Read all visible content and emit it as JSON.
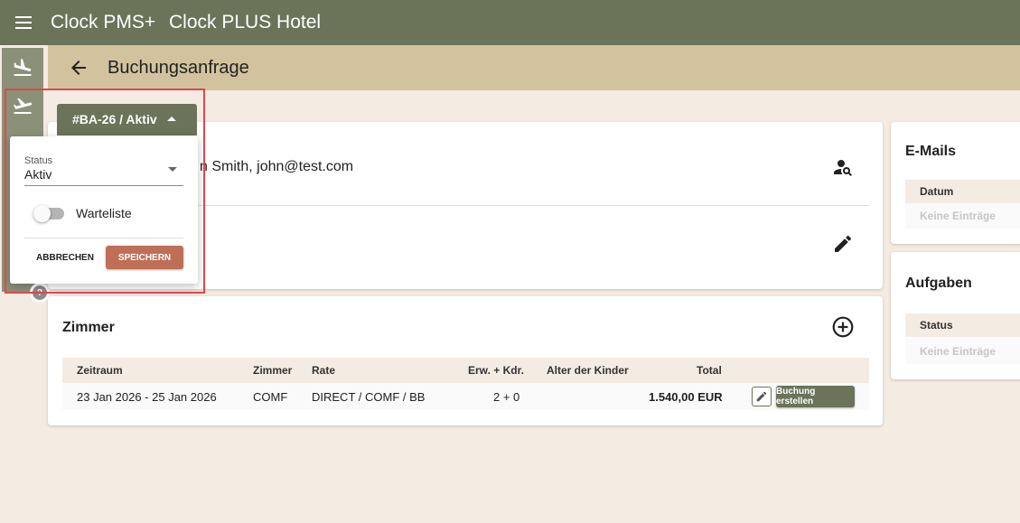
{
  "app": {
    "name": "Clock PMS+",
    "hotel": "Clock PLUS Hotel"
  },
  "header": {
    "title": "Buchungsanfrage"
  },
  "nav_rail": {
    "items": [
      {
        "icon": "flight-land-icon"
      },
      {
        "icon": "flight-takeoff-icon"
      }
    ],
    "help_label": "?"
  },
  "status_chip": {
    "label": "#BA-26 / Aktiv"
  },
  "status_popup": {
    "status_label": "Status",
    "status_value": "Aktiv",
    "waitlist_label": "Warteliste",
    "waitlist_enabled": false,
    "cancel_label": "ABBRECHEN",
    "save_label": "SPEICHERN"
  },
  "guest": {
    "text": "n Smith, john@test.com"
  },
  "rooms": {
    "title": "Zimmer",
    "columns": [
      "Zeitraum",
      "Zimmer",
      "Rate",
      "Erw. + Kdr.",
      "Alter der Kinder",
      "Total"
    ],
    "rows": [
      {
        "period": "23 Jan 2026 - 25 Jan 2026",
        "room": "COMF",
        "rate": "DIRECT / COMF / BB",
        "guests": "2 + 0",
        "child_ages": "",
        "total": "1.540,00 EUR",
        "action_label": "Buchung erstellen"
      }
    ]
  },
  "emails": {
    "title": "E-Mails",
    "column": "Datum",
    "empty": "Keine Einträge"
  },
  "tasks": {
    "title": "Aufgaben",
    "column": "Status",
    "empty": "Keine Einträge"
  },
  "colors": {
    "primary": "#6b7359",
    "subheader": "#d3c29e",
    "background": "#f4ebe2",
    "accent": "#c06f57",
    "highlight": "#e0474c"
  }
}
